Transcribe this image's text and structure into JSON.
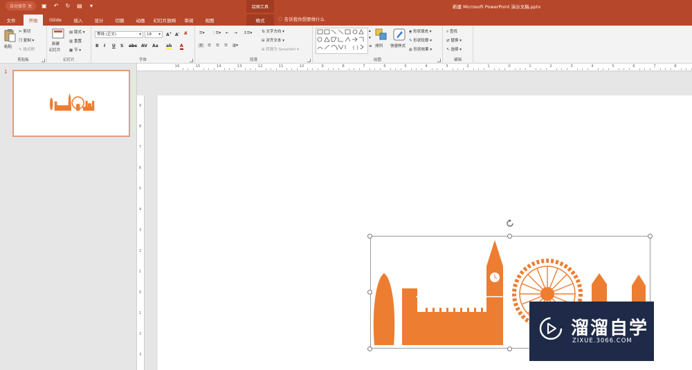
{
  "titlebar": {
    "autosave": "自动保存",
    "autosave_state": "关",
    "tools_label": "绘图工具",
    "doc_title": "新建 Microsoft PowerPoint 演示文稿.pptx"
  },
  "tabs": {
    "file": "文件",
    "home": "开始",
    "islide": "iSlide",
    "insert": "插入",
    "design": "设计",
    "transitions": "切换",
    "animations": "动画",
    "slideshow": "幻灯片放映",
    "review": "审阅",
    "view": "视图",
    "format": "格式",
    "tellme": "告诉我你想要做什么"
  },
  "ribbon": {
    "clipboard": {
      "paste": "粘贴",
      "cut": "剪切",
      "copy": "复制",
      "format_painter": "格式刷",
      "label": "剪贴板"
    },
    "slides": {
      "new_slide": "新建",
      "new_slide2": "幻灯片",
      "layout": "版式",
      "reset": "重置",
      "section": "节",
      "label": "幻灯片"
    },
    "font": {
      "font_name": "等线 (正文)",
      "font_size": "18",
      "label": "字体"
    },
    "paragraph": {
      "text_direction": "文字方向",
      "align_text": "对齐文本",
      "smartart": "转换为 SmartArt",
      "label": "段落"
    },
    "drawing": {
      "arrange": "排列",
      "quick_styles": "快速样式",
      "shape_fill": "形状填充",
      "shape_outline": "形状轮廓",
      "shape_effects": "形状效果",
      "label": "绘图"
    },
    "editing": {
      "find": "查找",
      "replace": "替换",
      "select": "选择",
      "label": "编辑"
    }
  },
  "ruler": {
    "h_ticks": [
      "16",
      "15",
      "14",
      "13",
      "12",
      "11",
      "10",
      "9",
      "8",
      "7",
      "6",
      "5",
      "4",
      "3",
      "2",
      "1",
      "0",
      "1",
      "2",
      "3",
      "4",
      "5",
      "6",
      "7",
      "8",
      "9"
    ],
    "v_ticks": [
      "9",
      "8",
      "7",
      "6",
      "5",
      "4",
      "3",
      "2",
      "1",
      "0",
      "1",
      "2",
      "3"
    ]
  },
  "thumbnails": [
    {
      "number": "1"
    }
  ],
  "watermark": {
    "title": "溜溜自学",
    "url": "ZIXUE.3066.COM"
  },
  "colors": {
    "accent": "#b7472a",
    "graphic": "#ed7d31",
    "watermark_bg": "#1e2a48"
  }
}
